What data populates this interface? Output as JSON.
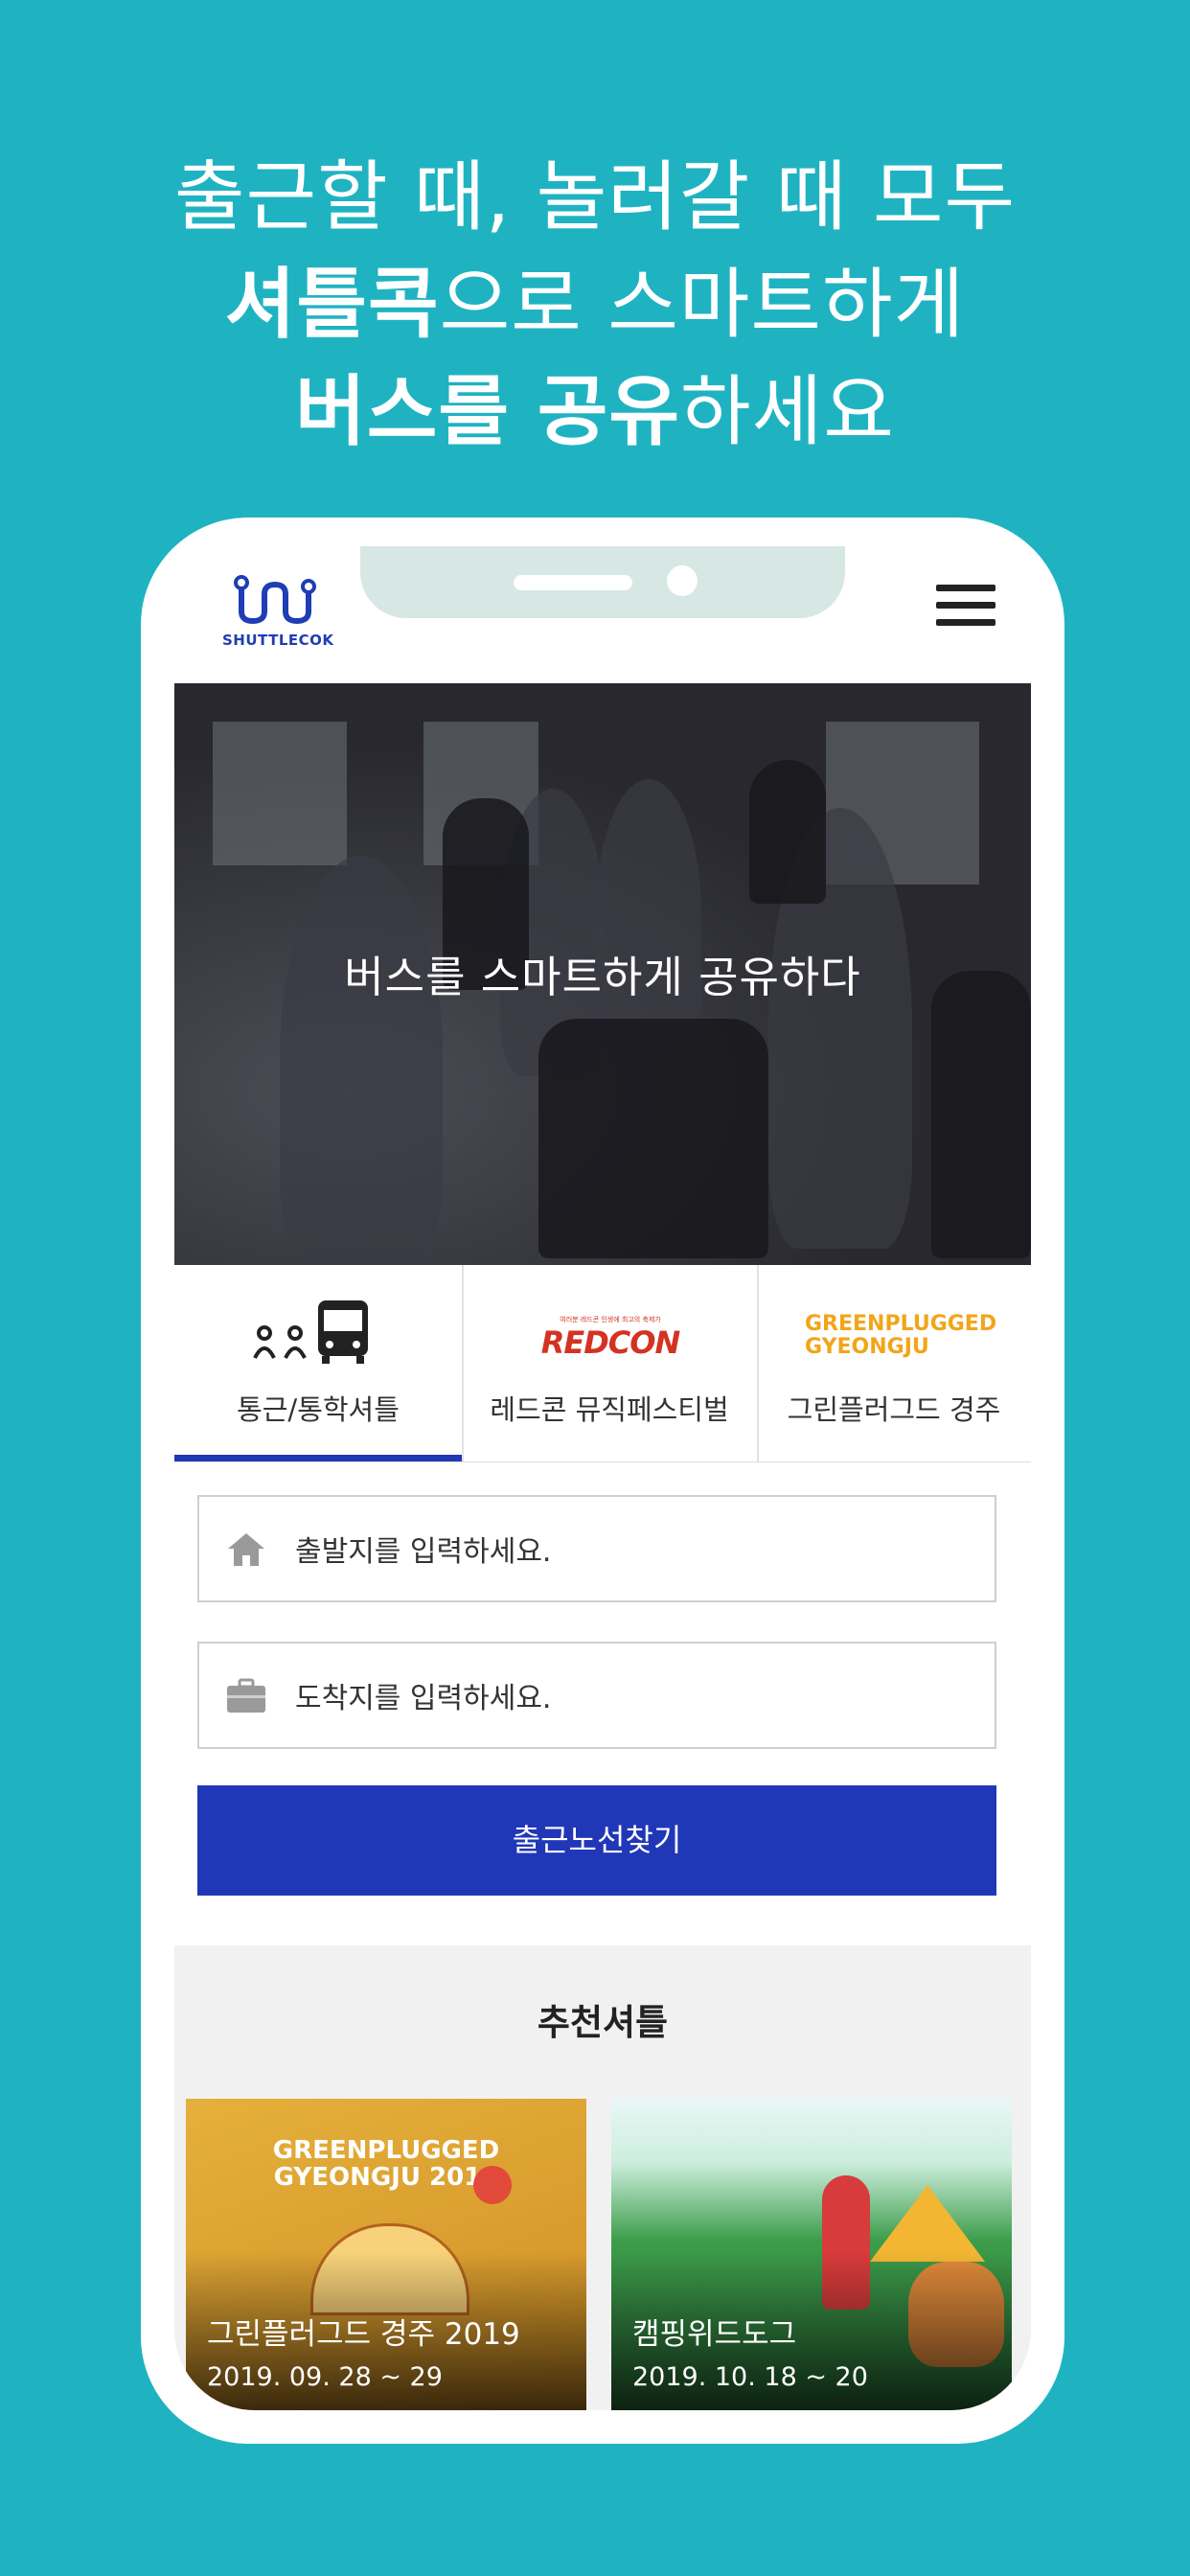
{
  "headline": {
    "line1": "출근할 때, 놀러갈 때 모두",
    "line2_bold": "셔틀콕",
    "line2_rest": "으로 스마트하게",
    "line3_bold": "버스를 공유",
    "line3_rest": "하세요"
  },
  "app": {
    "logo_text": "SHUTTLECOK",
    "hero_title": "버스를 스마트하게 공유하다",
    "tabs": [
      {
        "label": "통근/통학셔틀",
        "active": true
      },
      {
        "label": "레드콘 뮤직페스티벌",
        "logo": "REDCON",
        "logo_small": "여러분 레드콘 인생에 최고의 축제가"
      },
      {
        "label": "그린플러그드 경주",
        "logo_line1": "GREENPLUGGED",
        "logo_line2": "GYEONGJU"
      }
    ],
    "departure_placeholder": "출발지를 입력하세요.",
    "arrival_placeholder": "도착지를 입력하세요.",
    "search_button": "출근노선찾기",
    "recommend_title": "추천셔틀",
    "cards": [
      {
        "title": "그린플러그드 경주 2019",
        "date": "2019. 09. 28 ~ 29",
        "poster_line1": "GREENPLUGGED",
        "poster_line2": "GYEONGJU 2019"
      },
      {
        "title": "캠핑위드도그",
        "date": "2019. 10. 18 ~ 20"
      }
    ]
  },
  "colors": {
    "background": "#1fb3c2",
    "primary": "#2037b7",
    "redcon": "#d43222",
    "greenplugged": "#f2a51a"
  }
}
